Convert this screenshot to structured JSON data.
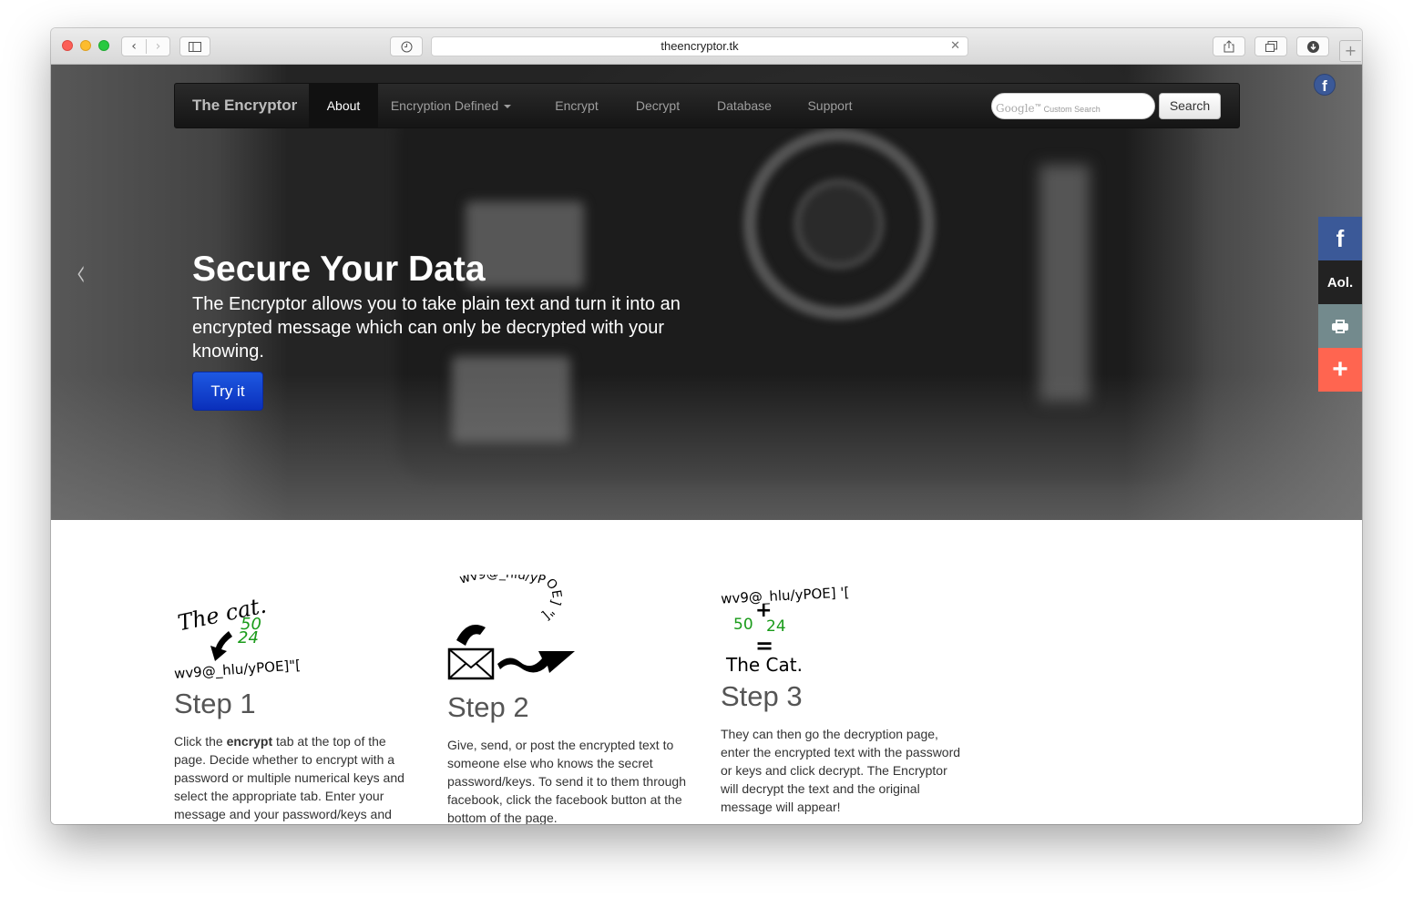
{
  "browser": {
    "url": "theencryptor.tk"
  },
  "nav": {
    "brand": "The Encryptor",
    "items": [
      "About",
      "Encryption Defined",
      "Encrypt",
      "Decrypt",
      "Database",
      "Support"
    ],
    "search_placeholder": "Custom Search",
    "search_logo": "Google",
    "search_button": "Search"
  },
  "hero": {
    "title": "Secure Your Data",
    "description": "The Encryptor allows you to take plain text and turn it into an encrypted message which can only be decrypted with your knowing.",
    "cta": "Try it"
  },
  "share": {
    "aol": "Aol.",
    "plus": "+"
  },
  "steps": [
    {
      "title": "Step 1",
      "text_before": "Click the ",
      "text_bold": "encrypt",
      "text_after": " tab at the top of the page. Decide whether to encrypt with a password or multiple numerical keys and select the appropriate tab. Enter your message and your password/keys and",
      "illus": {
        "plain": "The cat.",
        "key1": "50",
        "key2": "24",
        "cipher": "wv9@_hlu/yPOE]\"["
      }
    },
    {
      "title": "Step 2",
      "text": "Give, send, or post the encrypted text to someone else who knows the secret password/keys. To send it to them through facebook, click the facebook button at the bottom of the page.",
      "illus": {
        "cipher": "wv9@_hlu/yPOE] \"["
      }
    },
    {
      "title": "Step 3",
      "text": "They can then go the decryption page, enter the encrypted text with the password or keys and click decrypt. The Encryptor will decrypt the text and the original message will appear!",
      "illus": {
        "cipher": "wv9@_hlu/yPOE] '[",
        "plus": "+",
        "key1": "50",
        "key2": "24",
        "equals": "=",
        "plain": "The Cat."
      }
    }
  ]
}
